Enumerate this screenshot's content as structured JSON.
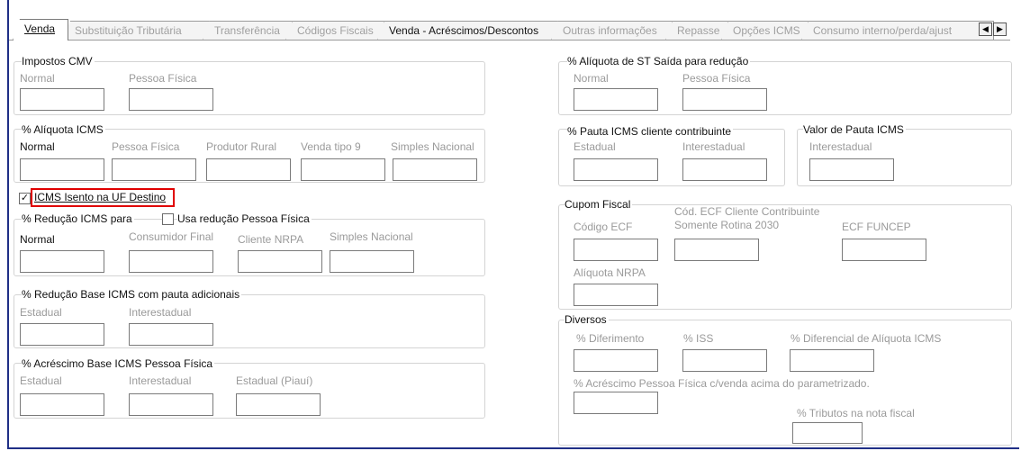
{
  "tabs": [
    {
      "label": "Venda"
    },
    {
      "label": "Substituição Tributária"
    },
    {
      "label": "Transferência"
    },
    {
      "label": "Códigos Fiscais"
    },
    {
      "label": "Venda - Acréscimos/Descontos"
    },
    {
      "label": "Outras informações"
    },
    {
      "label": "Repasse"
    },
    {
      "label": "Opções ICMS"
    },
    {
      "label": "Consumo interno/perda/ajust"
    }
  ],
  "scroll": {
    "left_glyph": "◀",
    "right_glyph": "▶"
  },
  "impostos_cmv": {
    "title": "Impostos CMV",
    "normal": "Normal",
    "pessoa_fisica": "Pessoa Física"
  },
  "aliquota_icms": {
    "title": "% Alíquota ICMS",
    "normal": "Normal",
    "pessoa_fisica": "Pessoa Física",
    "produtor_rural": "Produtor Rural",
    "venda_tipo9": "Venda tipo 9",
    "simples_nacional": "Simples Nacional"
  },
  "icms_isento": {
    "label": "ICMS Isento na UF Destino",
    "checked": true,
    "check_glyph": "✓"
  },
  "reducao_icms": {
    "title": "% Redução ICMS para",
    "usa_reducao_pf": "Usa redução Pessoa Física",
    "normal": "Normal",
    "consumidor_final": "Consumidor Final",
    "cliente_nrpa": "Cliente NRPA",
    "simples_nacional": "Simples Nacional"
  },
  "reducao_base": {
    "title": "% Redução Base ICMS com pauta adicionais",
    "estadual": "Estadual",
    "interestadual": "Interestadual"
  },
  "acrescimo_base": {
    "title": "% Acréscimo Base ICMS Pessoa Física",
    "estadual": "Estadual",
    "interestadual": "Interestadual",
    "estadual_piaui": "Estadual (Piauí)"
  },
  "st_saida": {
    "title": "% Alíquota de ST Saída para redução",
    "normal": "Normal",
    "pessoa_fisica": "Pessoa Física"
  },
  "pauta_icms": {
    "title": "% Pauta ICMS cliente contribuinte",
    "estadual": "Estadual",
    "interestadual": "Interestadual"
  },
  "valor_pauta": {
    "title": "Valor de Pauta ICMS",
    "interestadual": "Interestadual"
  },
  "cupom_fiscal": {
    "title": "Cupom Fiscal",
    "codigo_ecf": "Código ECF",
    "cod_ecf_cliente_1": "Cód. ECF Cliente Contribuinte",
    "cod_ecf_cliente_2": "Somente Rotina 2030",
    "ecf_funcep": "ECF FUNCEP",
    "aliquota_nrpa": "Alíquota NRPA"
  },
  "diversos": {
    "title": "Diversos",
    "diferimento": "% Diferimento",
    "iss": "% ISS",
    "diferencial": "% Diferencial de Alíquota ICMS",
    "acrescimo_pf": "% Acréscimo Pessoa Física c/venda acima do parametrizado.",
    "tributos": "% Tributos na nota fiscal"
  }
}
